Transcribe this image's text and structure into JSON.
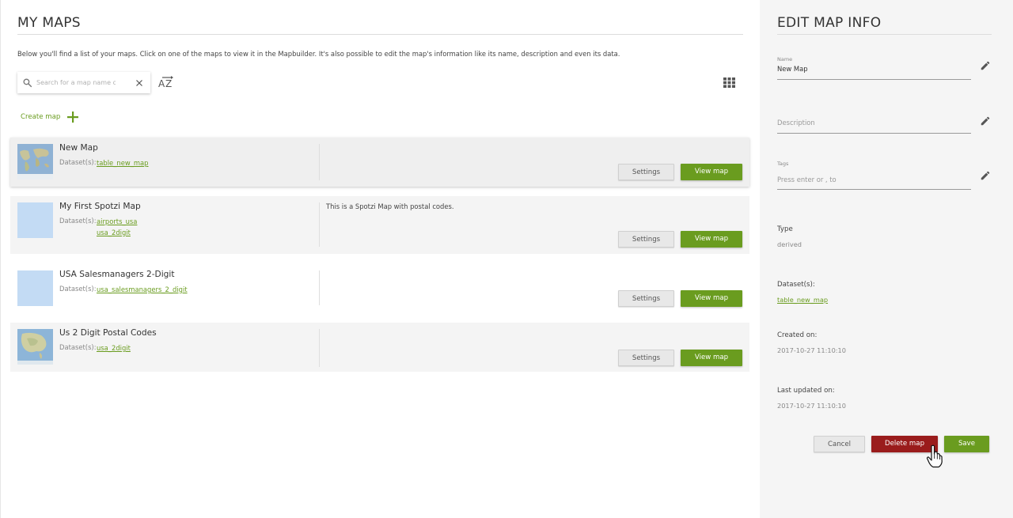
{
  "main": {
    "title": "MY MAPS",
    "intro": "Below you'll find a list of your maps. Click on one of the maps to view it in the Mapbuilder. It's also possible to edit the map's information like its name, description and even its data.",
    "search_placeholder": "Search for a map name o",
    "sort_label": "AZ",
    "create_label": "Create map",
    "dataset_label": "Dataset(s):",
    "settings_label": "Settings",
    "view_label": "View map",
    "maps": [
      {
        "name": "New Map",
        "datasets": [
          "table_new_map"
        ],
        "description": ""
      },
      {
        "name": "My First Spotzi Map",
        "datasets": [
          "airports_usa",
          "usa_2digit"
        ],
        "description": "This is a Spotzi Map with postal codes."
      },
      {
        "name": "USA Salesmanagers 2-Digit",
        "datasets": [
          "usa_salesmanagers_2_digit"
        ],
        "description": ""
      },
      {
        "name": "Us 2 Digit Postal Codes",
        "datasets": [
          "usa_2digit"
        ],
        "description": ""
      }
    ]
  },
  "side": {
    "title": "EDIT MAP INFO",
    "name_label": "Name",
    "name_value": "New Map",
    "description_placeholder": "Description",
    "tags_label": "Tags",
    "tags_placeholder": "Press enter or , to",
    "type_label": "Type",
    "type_value": "derived",
    "datasets_label": "Dataset(s):",
    "datasets_value": "table_new_map",
    "created_label": "Created on:",
    "created_value": "2017-10-27 11:10:10",
    "updated_label": "Last updated on:",
    "updated_value": "2017-10-27 11:10:10",
    "cancel_label": "Cancel",
    "delete_label": "Delete map",
    "save_label": "Save"
  },
  "colors": {
    "accent": "#6a9c1f",
    "danger": "#9a1c1c",
    "panel": "#f5f5f5"
  },
  "icons": [
    "search-icon",
    "clear-icon",
    "sort-az-icon",
    "grid-view-icon",
    "plus-icon",
    "pencil-icon",
    "hand-cursor-icon"
  ]
}
